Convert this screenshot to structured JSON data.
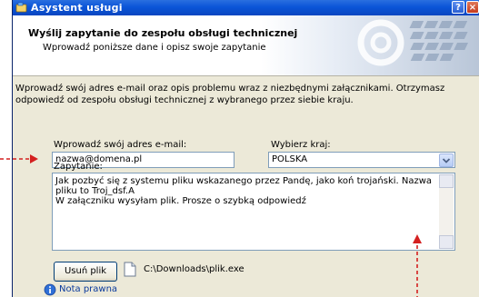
{
  "window": {
    "title": "Asystent usługi",
    "help_btn": "?",
    "close_btn": "×"
  },
  "header": {
    "title": "Wyślij zapytanie do zespołu obsługi technicznej",
    "subtitle": "Wprowadź poniższe dane i opisz swoje zapytanie"
  },
  "intro_text": "Wprowadź swój adres e-mail oraz opis problemu wraz z niezbędnymi załącznikami. Otrzymasz odpowiedź od zespołu obsługi technicznej z wybranego przez siebie kraju.",
  "email": {
    "label": "Wprowadź swój adres e-mail:",
    "value": "nazwa@domena.pl"
  },
  "country": {
    "label": "Wybierz kraj:",
    "selected": "POLSKA"
  },
  "query": {
    "label": "Zapytanie:",
    "lines": [
      "Jak pozbyć się z systemu pliku wskazanego przez Pandę, jako koń trojański. Nazwa",
      "pliku to Troj_dsf.A",
      "W załączniku wysyłam plik. Prosze o szybką odpowiedź"
    ]
  },
  "attachment": {
    "remove_button": "Usuń plik",
    "file_path": "C:\\Downloads\\plik.exe"
  },
  "legal_link": "Nota prawna",
  "colors": {
    "titlebar": "#0b55d8",
    "window_bg": "#ece9d8",
    "annotation": "#d42020",
    "link": "#0a3a9c"
  },
  "icons": [
    "window-app-icon",
    "help-icon",
    "close-icon",
    "chevron-down-icon",
    "file-icon",
    "info-icon"
  ]
}
